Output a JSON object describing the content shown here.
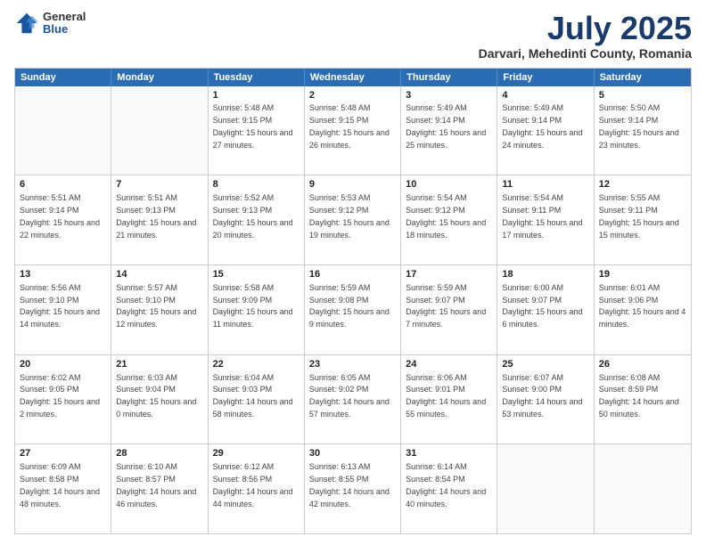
{
  "header": {
    "logo": {
      "general": "General",
      "blue": "Blue"
    },
    "title": "July 2025",
    "subtitle": "Darvari, Mehedinti County, Romania"
  },
  "calendar": {
    "days": [
      "Sunday",
      "Monday",
      "Tuesday",
      "Wednesday",
      "Thursday",
      "Friday",
      "Saturday"
    ],
    "rows": [
      [
        {
          "day": "",
          "sunrise": "",
          "sunset": "",
          "daylight": ""
        },
        {
          "day": "",
          "sunrise": "",
          "sunset": "",
          "daylight": ""
        },
        {
          "day": "1",
          "sunrise": "Sunrise: 5:48 AM",
          "sunset": "Sunset: 9:15 PM",
          "daylight": "Daylight: 15 hours and 27 minutes."
        },
        {
          "day": "2",
          "sunrise": "Sunrise: 5:48 AM",
          "sunset": "Sunset: 9:15 PM",
          "daylight": "Daylight: 15 hours and 26 minutes."
        },
        {
          "day": "3",
          "sunrise": "Sunrise: 5:49 AM",
          "sunset": "Sunset: 9:14 PM",
          "daylight": "Daylight: 15 hours and 25 minutes."
        },
        {
          "day": "4",
          "sunrise": "Sunrise: 5:49 AM",
          "sunset": "Sunset: 9:14 PM",
          "daylight": "Daylight: 15 hours and 24 minutes."
        },
        {
          "day": "5",
          "sunrise": "Sunrise: 5:50 AM",
          "sunset": "Sunset: 9:14 PM",
          "daylight": "Daylight: 15 hours and 23 minutes."
        }
      ],
      [
        {
          "day": "6",
          "sunrise": "Sunrise: 5:51 AM",
          "sunset": "Sunset: 9:14 PM",
          "daylight": "Daylight: 15 hours and 22 minutes."
        },
        {
          "day": "7",
          "sunrise": "Sunrise: 5:51 AM",
          "sunset": "Sunset: 9:13 PM",
          "daylight": "Daylight: 15 hours and 21 minutes."
        },
        {
          "day": "8",
          "sunrise": "Sunrise: 5:52 AM",
          "sunset": "Sunset: 9:13 PM",
          "daylight": "Daylight: 15 hours and 20 minutes."
        },
        {
          "day": "9",
          "sunrise": "Sunrise: 5:53 AM",
          "sunset": "Sunset: 9:12 PM",
          "daylight": "Daylight: 15 hours and 19 minutes."
        },
        {
          "day": "10",
          "sunrise": "Sunrise: 5:54 AM",
          "sunset": "Sunset: 9:12 PM",
          "daylight": "Daylight: 15 hours and 18 minutes."
        },
        {
          "day": "11",
          "sunrise": "Sunrise: 5:54 AM",
          "sunset": "Sunset: 9:11 PM",
          "daylight": "Daylight: 15 hours and 17 minutes."
        },
        {
          "day": "12",
          "sunrise": "Sunrise: 5:55 AM",
          "sunset": "Sunset: 9:11 PM",
          "daylight": "Daylight: 15 hours and 15 minutes."
        }
      ],
      [
        {
          "day": "13",
          "sunrise": "Sunrise: 5:56 AM",
          "sunset": "Sunset: 9:10 PM",
          "daylight": "Daylight: 15 hours and 14 minutes."
        },
        {
          "day": "14",
          "sunrise": "Sunrise: 5:57 AM",
          "sunset": "Sunset: 9:10 PM",
          "daylight": "Daylight: 15 hours and 12 minutes."
        },
        {
          "day": "15",
          "sunrise": "Sunrise: 5:58 AM",
          "sunset": "Sunset: 9:09 PM",
          "daylight": "Daylight: 15 hours and 11 minutes."
        },
        {
          "day": "16",
          "sunrise": "Sunrise: 5:59 AM",
          "sunset": "Sunset: 9:08 PM",
          "daylight": "Daylight: 15 hours and 9 minutes."
        },
        {
          "day": "17",
          "sunrise": "Sunrise: 5:59 AM",
          "sunset": "Sunset: 9:07 PM",
          "daylight": "Daylight: 15 hours and 7 minutes."
        },
        {
          "day": "18",
          "sunrise": "Sunrise: 6:00 AM",
          "sunset": "Sunset: 9:07 PM",
          "daylight": "Daylight: 15 hours and 6 minutes."
        },
        {
          "day": "19",
          "sunrise": "Sunrise: 6:01 AM",
          "sunset": "Sunset: 9:06 PM",
          "daylight": "Daylight: 15 hours and 4 minutes."
        }
      ],
      [
        {
          "day": "20",
          "sunrise": "Sunrise: 6:02 AM",
          "sunset": "Sunset: 9:05 PM",
          "daylight": "Daylight: 15 hours and 2 minutes."
        },
        {
          "day": "21",
          "sunrise": "Sunrise: 6:03 AM",
          "sunset": "Sunset: 9:04 PM",
          "daylight": "Daylight: 15 hours and 0 minutes."
        },
        {
          "day": "22",
          "sunrise": "Sunrise: 6:04 AM",
          "sunset": "Sunset: 9:03 PM",
          "daylight": "Daylight: 14 hours and 58 minutes."
        },
        {
          "day": "23",
          "sunrise": "Sunrise: 6:05 AM",
          "sunset": "Sunset: 9:02 PM",
          "daylight": "Daylight: 14 hours and 57 minutes."
        },
        {
          "day": "24",
          "sunrise": "Sunrise: 6:06 AM",
          "sunset": "Sunset: 9:01 PM",
          "daylight": "Daylight: 14 hours and 55 minutes."
        },
        {
          "day": "25",
          "sunrise": "Sunrise: 6:07 AM",
          "sunset": "Sunset: 9:00 PM",
          "daylight": "Daylight: 14 hours and 53 minutes."
        },
        {
          "day": "26",
          "sunrise": "Sunrise: 6:08 AM",
          "sunset": "Sunset: 8:59 PM",
          "daylight": "Daylight: 14 hours and 50 minutes."
        }
      ],
      [
        {
          "day": "27",
          "sunrise": "Sunrise: 6:09 AM",
          "sunset": "Sunset: 8:58 PM",
          "daylight": "Daylight: 14 hours and 48 minutes."
        },
        {
          "day": "28",
          "sunrise": "Sunrise: 6:10 AM",
          "sunset": "Sunset: 8:57 PM",
          "daylight": "Daylight: 14 hours and 46 minutes."
        },
        {
          "day": "29",
          "sunrise": "Sunrise: 6:12 AM",
          "sunset": "Sunset: 8:56 PM",
          "daylight": "Daylight: 14 hours and 44 minutes."
        },
        {
          "day": "30",
          "sunrise": "Sunrise: 6:13 AM",
          "sunset": "Sunset: 8:55 PM",
          "daylight": "Daylight: 14 hours and 42 minutes."
        },
        {
          "day": "31",
          "sunrise": "Sunrise: 6:14 AM",
          "sunset": "Sunset: 8:54 PM",
          "daylight": "Daylight: 14 hours and 40 minutes."
        },
        {
          "day": "",
          "sunrise": "",
          "sunset": "",
          "daylight": ""
        },
        {
          "day": "",
          "sunrise": "",
          "sunset": "",
          "daylight": ""
        }
      ]
    ]
  }
}
